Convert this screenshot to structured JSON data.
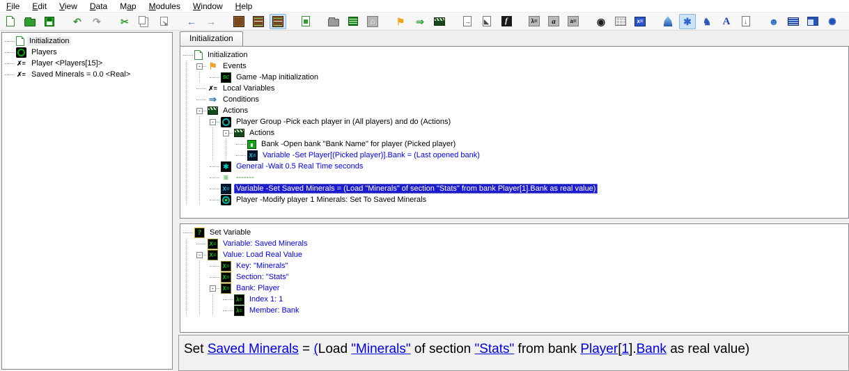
{
  "menu": {
    "items": [
      {
        "label": "File",
        "accel": 0
      },
      {
        "label": "Edit",
        "accel": 0
      },
      {
        "label": "View",
        "accel": 0
      },
      {
        "label": "Data",
        "accel": 0
      },
      {
        "label": "Map",
        "accel": 1
      },
      {
        "label": "Modules",
        "accel": 0
      },
      {
        "label": "Window",
        "accel": 0
      },
      {
        "label": "Help",
        "accel": 0
      }
    ]
  },
  "toolbar": {
    "icons": [
      {
        "name": "new-document-icon",
        "cls": "i-page-green"
      },
      {
        "name": "open-document-icon",
        "cls": "i-folder-green"
      },
      {
        "name": "save-icon",
        "cls": "i-floppy"
      },
      {
        "name": "undo-icon",
        "glyph": "↶",
        "fg": "#3a9a3a",
        "gap": true
      },
      {
        "name": "redo-icon",
        "glyph": "↷",
        "fg": "#9a9a9a"
      },
      {
        "name": "cut-icon",
        "glyph": "✂",
        "fg": "#3a9a3a",
        "gap": true
      },
      {
        "name": "copy-icon",
        "cls": "i-copy"
      },
      {
        "name": "paste-icon",
        "cls": "i-paste"
      },
      {
        "name": "back-icon",
        "glyph": "←",
        "fg": "#3a6ac8",
        "gap": true
      },
      {
        "name": "forward-icon",
        "glyph": "→",
        "fg": "#8a8a8a"
      },
      {
        "name": "terrain-editor-icon",
        "cls": "i-brown",
        "gap": true
      },
      {
        "name": "data-editor-icon",
        "cls": "i-brown l"
      },
      {
        "name": "trigger-editor-icon",
        "cls": "i-brown l",
        "sel": true
      },
      {
        "name": "import-editor-icon",
        "cls": "i-page-green2",
        "gap": true
      },
      {
        "name": "libraries-icon",
        "cls": "i-folder-gray",
        "gap": true
      },
      {
        "name": "overview-manager-icon",
        "cls": "i-list-green"
      },
      {
        "name": "map-info-icon",
        "cls": "i-gray-house",
        "glyph": "⌂"
      },
      {
        "name": "new-event-icon",
        "glyph": "⚑",
        "fg": "#eda41e",
        "gap": true
      },
      {
        "name": "new-condition-icon",
        "glyph": "⇒",
        "fg": "#2f9e2f"
      },
      {
        "name": "new-action-icon",
        "cls": "i-clap"
      },
      {
        "name": "new-element-icon",
        "cls": "i-page-arrow",
        "gap": true
      },
      {
        "name": "new-comment-icon",
        "cls": "i-page-arrow d"
      },
      {
        "name": "new-function-icon",
        "cls": "i-black-f",
        "glyph": "f"
      },
      {
        "name": "parameter-icon",
        "cls": "i-silver",
        "glyph": "λ=",
        "gap": true
      },
      {
        "name": "attribute-icon",
        "cls": "i-silver i",
        "glyph": "a"
      },
      {
        "name": "constant-icon",
        "cls": "i-silver",
        "glyph": "a="
      },
      {
        "name": "record-icon",
        "glyph": "◉",
        "fg": "#1a1a1a",
        "gap": true
      },
      {
        "name": "preset-icon",
        "cls": "i-table"
      },
      {
        "name": "new-variable-icon",
        "cls": "i-blue-x",
        "glyph": "x="
      },
      {
        "name": "script-icon",
        "cls": "i-flame",
        "gap": true
      },
      {
        "name": "view-raw-data-icon",
        "glyph": "✱",
        "fg": "#2f66c8",
        "sel": true
      },
      {
        "name": "unit-icon",
        "glyph": "♞",
        "fg": "#2f55c0"
      },
      {
        "name": "text-style-icon",
        "glyph": "A",
        "fg": "#2443b8",
        "big": true
      },
      {
        "name": "export-script-icon",
        "cls": "i-page-down"
      },
      {
        "name": "portrait-icon",
        "glyph": "☻",
        "fg": "#2f66c8",
        "gap": true
      },
      {
        "name": "bank-toolbar-icon",
        "cls": "i-disk"
      },
      {
        "name": "window-layout-icon",
        "cls": "i-panelic"
      },
      {
        "name": "cutscene-icon",
        "glyph": "✺",
        "fg": "#2450b8"
      },
      {
        "name": "test-document-icon",
        "glyph": "✤",
        "fg": "#2f9e2f",
        "gap": true
      }
    ]
  },
  "left_tree": {
    "items": [
      {
        "label": "Initialization",
        "icon": "page",
        "selected": true
      },
      {
        "label": "Players",
        "icon": "trigger"
      },
      {
        "label": "Player <Players[15]>",
        "icon": "xeq-black"
      },
      {
        "label": "Saved Minerals = 0.0 <Real>",
        "icon": "xeq-black"
      }
    ]
  },
  "tab": {
    "label": "Initialization"
  },
  "trigger_tree": {
    "rows": [
      {
        "label": "Initialization",
        "icon": "page",
        "level": 0
      },
      {
        "label": "Events",
        "icon": "flag",
        "level": 1,
        "exp": true
      },
      {
        "label": "Game -Map initialization",
        "icon": "game",
        "level": 2
      },
      {
        "label": "Local Variables",
        "icon": "xeq-black",
        "level": 1
      },
      {
        "label": "Conditions",
        "icon": "cond",
        "level": 1
      },
      {
        "label": "Actions",
        "icon": "clap",
        "level": 1,
        "exp": true
      },
      {
        "label": "Player Group -Pick each player in (All players) and do (Actions)",
        "icon": "pgroup",
        "level": 2,
        "exp": true
      },
      {
        "label": "Actions",
        "icon": "clap",
        "level": 3,
        "exp": true
      },
      {
        "label": "Bank -Open bank \"Bank Name\" for player (Picked player)",
        "icon": "bank",
        "level": 4
      },
      {
        "label": "Variable -Set Player[(Picked player)].Bank = (Last opened bank)",
        "icon": "xeq-dark",
        "level": 4,
        "color": "blue"
      },
      {
        "label": "General -Wait 0.5 Real Time seconds",
        "icon": "gear",
        "level": 2,
        "color": "blue"
      },
      {
        "label": "-------",
        "icon": "comment",
        "level": 2,
        "color": "green"
      },
      {
        "label": "Variable -Set Saved Minerals = (Load \"Minerals\" of section \"Stats\" from bank Player[1].Bank as real value)",
        "icon": "xeq-dark",
        "level": 2,
        "selected": true
      },
      {
        "label": "Player -Modify player 1 Minerals: Set To Saved Minerals",
        "icon": "player",
        "level": 2
      }
    ]
  },
  "detail_tree": {
    "rows": [
      {
        "label": "Set Variable",
        "icon": "qmark",
        "level": 0
      },
      {
        "label": "Variable: Saved Minerals",
        "icon": "xeq-olive",
        "level": 1,
        "color": "blue"
      },
      {
        "label": "Value: Load Real Value",
        "icon": "xeq-olive",
        "level": 1,
        "color": "blue",
        "exp": true
      },
      {
        "label": "Key: \"Minerals\"",
        "icon": "xeq-olive",
        "level": 2,
        "color": "blue"
      },
      {
        "label": "Section: \"Stats\"",
        "icon": "xeq-olive",
        "level": 2,
        "color": "blue"
      },
      {
        "label": "Bank: Player",
        "icon": "xeq-olive",
        "level": 2,
        "color": "blue",
        "exp": true
      },
      {
        "label": "Index 1: 1",
        "icon": "lameq",
        "level": 3,
        "color": "blue"
      },
      {
        "label": "Member: Bank",
        "icon": "lameq",
        "level": 3,
        "color": "blue"
      }
    ]
  },
  "statement": {
    "segments": [
      {
        "t": "Set ",
        "link": false
      },
      {
        "t": "Saved Minerals",
        "link": true
      },
      {
        "t": " = ",
        "link": false
      },
      {
        "t": "(",
        "link": true
      },
      {
        "t": "Load ",
        "link": false
      },
      {
        "t": "\"Minerals\"",
        "link": true
      },
      {
        "t": " of section ",
        "link": false
      },
      {
        "t": "\"Stats\"",
        "link": true
      },
      {
        "t": " from bank ",
        "link": false
      },
      {
        "t": "Player",
        "link": true
      },
      {
        "t": "[",
        "link": false
      },
      {
        "t": "1",
        "link": true
      },
      {
        "t": "].",
        "link": false
      },
      {
        "t": "Bank",
        "link": true
      },
      {
        "t": " as real value)",
        "link": false
      }
    ]
  },
  "colors": {
    "selection_bg": "#1b1bd0",
    "link_blue": "#0000e5",
    "action_blue": "#0000f0",
    "comment_green": "#1a8a1a",
    "toolbar_selected_bg": "#cde4f7"
  }
}
